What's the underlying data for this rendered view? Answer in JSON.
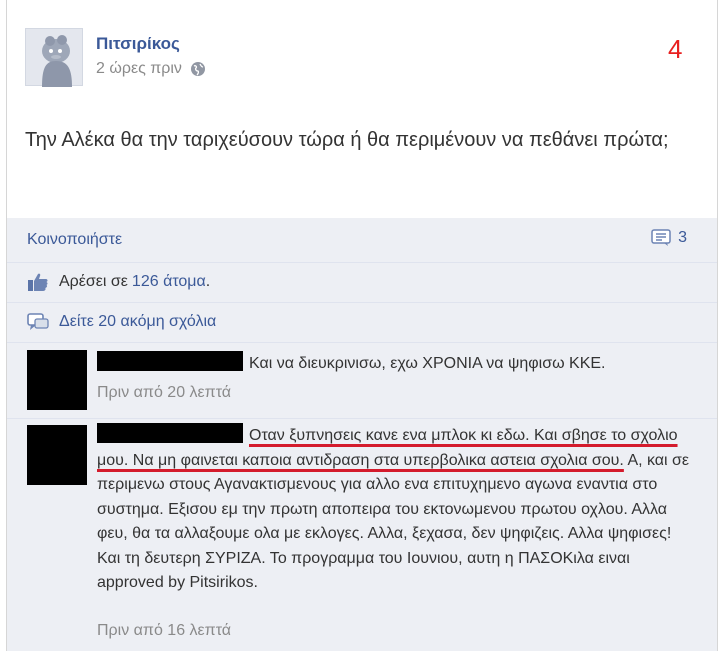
{
  "post": {
    "author": "Πιτσιρίκος",
    "time": "2 ώρες πριν",
    "annotation_number": "4",
    "text": "Την Αλέκα θα την ταριχεύσουν τώρα ή θα περιμένουν να πεθάνει πρώτα;"
  },
  "actions": {
    "share": "Κοινοποιήστε",
    "comments_count": "3"
  },
  "likes": {
    "prefix": "Αρέσει σε",
    "count": "126 άτομα",
    "suffix": "."
  },
  "more_comments": "Δείτε 20 ακόμη σχόλια",
  "comments": [
    {
      "name": "",
      "text": "Και να διευκρινισω, εχω ΧΡΟΝΙΑ να ψηφισω ΚΚΕ.",
      "time": "Πριν από 20 λεπτά"
    },
    {
      "name": "",
      "text_underlined": "Οταν ξυπνησεις κανε ενα μπλοκ κι εδω. Και σβησε το σχολιο μου. Να μη φαινεται καποια αντιδραση στα υπερβολικα αστεια σχολια σου.",
      "text_rest": " Α, και σε περιμενω στους Αγανακτισμενους για αλλο ενα επιτυχημενο αγωνα εναντια στο συστημα. Εξισου εμ την πρωτη αποπειρα του εκτονωμενου πρωτου οχλου. Αλλα φευ, θα τα αλλαξουμε ολα με εκλογες. Αλλα, ξεχασα, δεν ψηφιζεις. Αλλα ψηφισες! Και τη δευτερη ΣΥΡΙΖΑ. Το προγραμμα του Ιουνιου, αυτη η ΠΑΣΟΚιλα ειναι approved by Pitsirikos.",
      "time": "Πριν από 16 λεπτά"
    }
  ],
  "colors": {
    "link": "#3b5998",
    "muted": "#8a8a8a",
    "feed_bg": "#edeff4",
    "annotation": "#e8201f",
    "underline": "#d41b2c"
  }
}
